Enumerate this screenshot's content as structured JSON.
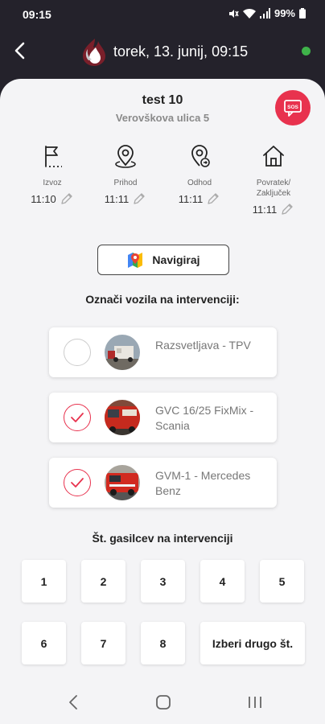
{
  "status": {
    "time": "09:15",
    "battery": "99%"
  },
  "header": {
    "title": "torek, 13. junij, 09:15",
    "status_color": "#3fb34a"
  },
  "incident": {
    "title": "test 10",
    "address": "Verovškova ulica 5",
    "sos_label": "SOS"
  },
  "timeline": [
    {
      "label": "Izvoz",
      "time": "11:10",
      "icon": "flag-icon"
    },
    {
      "label": "Prihod",
      "time": "11:11",
      "icon": "location-pin-icon"
    },
    {
      "label": "Odhod",
      "time": "11:11",
      "icon": "location-departure-icon"
    },
    {
      "label": "Povratek/ Zaključek",
      "time": "11:11",
      "icon": "home-icon"
    }
  ],
  "navigate": {
    "label": "Navigiraj",
    "icon": "maps-icon"
  },
  "vehicles_heading": "Označi vozila na intervenciji:",
  "vehicles": [
    {
      "name": "Razsvetljava - TPV",
      "checked": false
    },
    {
      "name": "GVC 16/25 FixMix - Scania",
      "checked": true
    },
    {
      "name": "GVM-1 - Mercedes Benz",
      "checked": true
    }
  ],
  "firefighters_heading": "Št. gasilcev na intervenciji",
  "counts": [
    "1",
    "2",
    "3",
    "4",
    "5",
    "6",
    "7",
    "8",
    "Izberi drugo št."
  ],
  "colors": {
    "accent": "#e8324e",
    "background": "#24222b",
    "surface": "#f4f4f6"
  }
}
